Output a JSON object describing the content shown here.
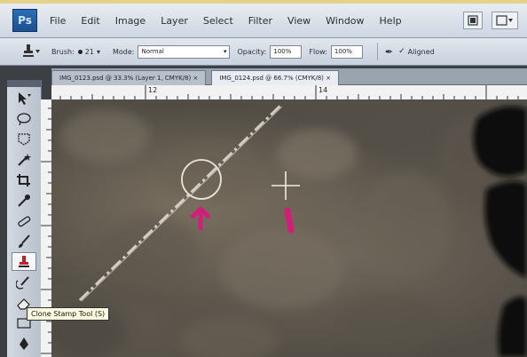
{
  "app": {
    "logo_text": "Ps"
  },
  "menubar": {
    "items": [
      "File",
      "Edit",
      "Image",
      "Layer",
      "Select",
      "Filter",
      "View",
      "Window",
      "Help"
    ]
  },
  "options_bar": {
    "brush_label": "Brush:",
    "brush_size": "21",
    "mode_label": "Mode:",
    "mode_value": "Normal",
    "opacity_label": "Opacity:",
    "opacity_value": "100%",
    "flow_label": "Flow:",
    "flow_value": "100%",
    "aligned_label": "Aligned"
  },
  "document_tabs": [
    {
      "label": "IMG_0123.psd @ 33.3% (Layer 1, CMYK/8) ×",
      "active": false
    },
    {
      "label": "IMG_0124.psd @ 66.7% (CMYK/8) ×",
      "active": true
    }
  ],
  "ruler": {
    "labels": [
      "12",
      "14"
    ]
  },
  "toolbox": {
    "tools": [
      "move-icon",
      "lasso-icon",
      "quick-select-icon",
      "crop-icon",
      "eyedropper-icon",
      "healing-brush-icon",
      "brush-icon",
      "clone-stamp-icon",
      "history-brush-icon",
      "eraser-icon"
    ],
    "selected": "clone-stamp-icon"
  },
  "tooltip": {
    "text": "Clone Stamp Tool (S)"
  },
  "colors": {
    "annotation_arrow": "#d21e7a",
    "menubar_bg": "#dfe5ec",
    "frame": "#e7d28a"
  }
}
